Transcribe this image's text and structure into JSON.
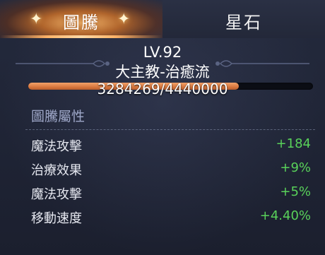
{
  "tabs": [
    {
      "label": "圖騰",
      "active": true
    },
    {
      "label": "星石",
      "active": false
    }
  ],
  "header": {
    "level": "LV.92",
    "name": "大主教-治癒流"
  },
  "progress": {
    "text": "3284269/4440000",
    "current": 3284269,
    "max": 4440000
  },
  "section": {
    "title": "圖騰屬性"
  },
  "stats": [
    {
      "name": "魔法攻擊",
      "value": "+184"
    },
    {
      "name": "治療效果",
      "value": "+9%"
    },
    {
      "name": "魔法攻擊",
      "value": "+5%"
    },
    {
      "name": "移動速度",
      "value": "+4.40%"
    }
  ],
  "colors": {
    "accent": "#f0a060",
    "positive": "#59d25a",
    "section_title": "#9ea7c8"
  },
  "icons": [
    "sparkle-icon",
    "ornament-icon"
  ]
}
